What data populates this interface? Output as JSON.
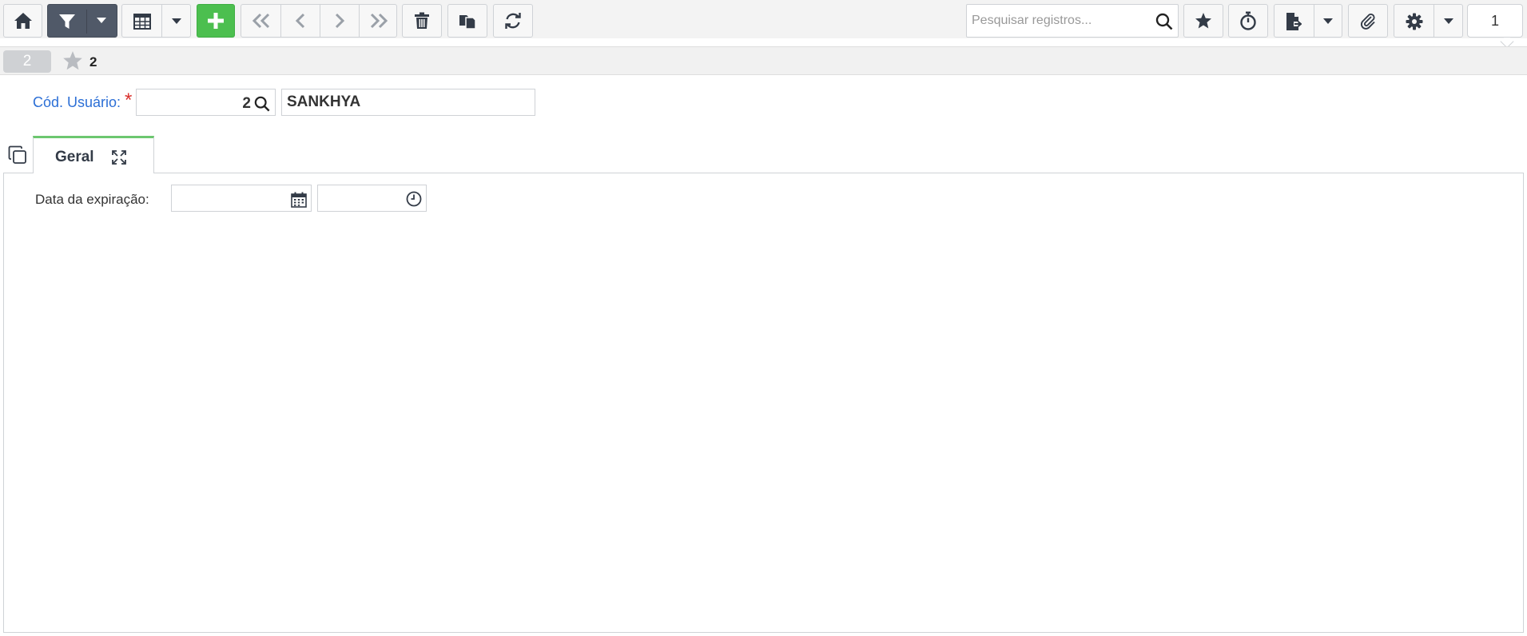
{
  "toolbar": {
    "search": {
      "placeholder": "Pesquisar registros..."
    },
    "record_counter": "1",
    "colors": {
      "filter_bg": "#505968",
      "add_bg": "#4cbf4f",
      "nav_icon": "#9aa0a8",
      "icon": "#333b47"
    },
    "icons": [
      "home-icon",
      "filter-icon",
      "chevron-down-icon",
      "grid-icon",
      "plus-icon",
      "first-record-icon",
      "previous-record-icon",
      "next-record-icon",
      "last-record-icon",
      "trash-icon",
      "duplicate-icon",
      "refresh-icon",
      "search-icon",
      "star-icon",
      "stopwatch-icon",
      "export-icon",
      "paperclip-icon",
      "gear-icon"
    ]
  },
  "record_bar": {
    "record_badge": "2",
    "favorites_count": "2"
  },
  "form": {
    "user_code_label": "Cód. Usuário:",
    "required_mark": "*",
    "user_code_value": "2",
    "user_name_value": "SANKHYA",
    "label_color": "#2c6fd6",
    "required_color": "#d9302c"
  },
  "tabs": [
    {
      "label": "Geral",
      "active": true,
      "accent": "#6cc76f"
    }
  ],
  "general_tab": {
    "expiration_label": "Data da expiração:",
    "expiration_date": "",
    "expiration_time": ""
  }
}
